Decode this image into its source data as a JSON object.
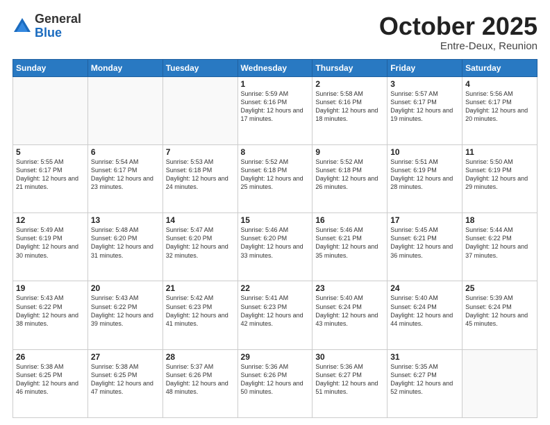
{
  "header": {
    "logo_general": "General",
    "logo_blue": "Blue",
    "title": "October 2025",
    "location": "Entre-Deux, Reunion"
  },
  "days_of_week": [
    "Sunday",
    "Monday",
    "Tuesday",
    "Wednesday",
    "Thursday",
    "Friday",
    "Saturday"
  ],
  "weeks": [
    [
      {
        "day": "",
        "info": ""
      },
      {
        "day": "",
        "info": ""
      },
      {
        "day": "",
        "info": ""
      },
      {
        "day": "1",
        "info": "Sunrise: 5:59 AM\nSunset: 6:16 PM\nDaylight: 12 hours and 17 minutes."
      },
      {
        "day": "2",
        "info": "Sunrise: 5:58 AM\nSunset: 6:16 PM\nDaylight: 12 hours and 18 minutes."
      },
      {
        "day": "3",
        "info": "Sunrise: 5:57 AM\nSunset: 6:17 PM\nDaylight: 12 hours and 19 minutes."
      },
      {
        "day": "4",
        "info": "Sunrise: 5:56 AM\nSunset: 6:17 PM\nDaylight: 12 hours and 20 minutes."
      }
    ],
    [
      {
        "day": "5",
        "info": "Sunrise: 5:55 AM\nSunset: 6:17 PM\nDaylight: 12 hours and 21 minutes."
      },
      {
        "day": "6",
        "info": "Sunrise: 5:54 AM\nSunset: 6:17 PM\nDaylight: 12 hours and 23 minutes."
      },
      {
        "day": "7",
        "info": "Sunrise: 5:53 AM\nSunset: 6:18 PM\nDaylight: 12 hours and 24 minutes."
      },
      {
        "day": "8",
        "info": "Sunrise: 5:52 AM\nSunset: 6:18 PM\nDaylight: 12 hours and 25 minutes."
      },
      {
        "day": "9",
        "info": "Sunrise: 5:52 AM\nSunset: 6:18 PM\nDaylight: 12 hours and 26 minutes."
      },
      {
        "day": "10",
        "info": "Sunrise: 5:51 AM\nSunset: 6:19 PM\nDaylight: 12 hours and 28 minutes."
      },
      {
        "day": "11",
        "info": "Sunrise: 5:50 AM\nSunset: 6:19 PM\nDaylight: 12 hours and 29 minutes."
      }
    ],
    [
      {
        "day": "12",
        "info": "Sunrise: 5:49 AM\nSunset: 6:19 PM\nDaylight: 12 hours and 30 minutes."
      },
      {
        "day": "13",
        "info": "Sunrise: 5:48 AM\nSunset: 6:20 PM\nDaylight: 12 hours and 31 minutes."
      },
      {
        "day": "14",
        "info": "Sunrise: 5:47 AM\nSunset: 6:20 PM\nDaylight: 12 hours and 32 minutes."
      },
      {
        "day": "15",
        "info": "Sunrise: 5:46 AM\nSunset: 6:20 PM\nDaylight: 12 hours and 33 minutes."
      },
      {
        "day": "16",
        "info": "Sunrise: 5:46 AM\nSunset: 6:21 PM\nDaylight: 12 hours and 35 minutes."
      },
      {
        "day": "17",
        "info": "Sunrise: 5:45 AM\nSunset: 6:21 PM\nDaylight: 12 hours and 36 minutes."
      },
      {
        "day": "18",
        "info": "Sunrise: 5:44 AM\nSunset: 6:22 PM\nDaylight: 12 hours and 37 minutes."
      }
    ],
    [
      {
        "day": "19",
        "info": "Sunrise: 5:43 AM\nSunset: 6:22 PM\nDaylight: 12 hours and 38 minutes."
      },
      {
        "day": "20",
        "info": "Sunrise: 5:43 AM\nSunset: 6:22 PM\nDaylight: 12 hours and 39 minutes."
      },
      {
        "day": "21",
        "info": "Sunrise: 5:42 AM\nSunset: 6:23 PM\nDaylight: 12 hours and 41 minutes."
      },
      {
        "day": "22",
        "info": "Sunrise: 5:41 AM\nSunset: 6:23 PM\nDaylight: 12 hours and 42 minutes."
      },
      {
        "day": "23",
        "info": "Sunrise: 5:40 AM\nSunset: 6:24 PM\nDaylight: 12 hours and 43 minutes."
      },
      {
        "day": "24",
        "info": "Sunrise: 5:40 AM\nSunset: 6:24 PM\nDaylight: 12 hours and 44 minutes."
      },
      {
        "day": "25",
        "info": "Sunrise: 5:39 AM\nSunset: 6:24 PM\nDaylight: 12 hours and 45 minutes."
      }
    ],
    [
      {
        "day": "26",
        "info": "Sunrise: 5:38 AM\nSunset: 6:25 PM\nDaylight: 12 hours and 46 minutes."
      },
      {
        "day": "27",
        "info": "Sunrise: 5:38 AM\nSunset: 6:25 PM\nDaylight: 12 hours and 47 minutes."
      },
      {
        "day": "28",
        "info": "Sunrise: 5:37 AM\nSunset: 6:26 PM\nDaylight: 12 hours and 48 minutes."
      },
      {
        "day": "29",
        "info": "Sunrise: 5:36 AM\nSunset: 6:26 PM\nDaylight: 12 hours and 50 minutes."
      },
      {
        "day": "30",
        "info": "Sunrise: 5:36 AM\nSunset: 6:27 PM\nDaylight: 12 hours and 51 minutes."
      },
      {
        "day": "31",
        "info": "Sunrise: 5:35 AM\nSunset: 6:27 PM\nDaylight: 12 hours and 52 minutes."
      },
      {
        "day": "",
        "info": ""
      }
    ]
  ]
}
